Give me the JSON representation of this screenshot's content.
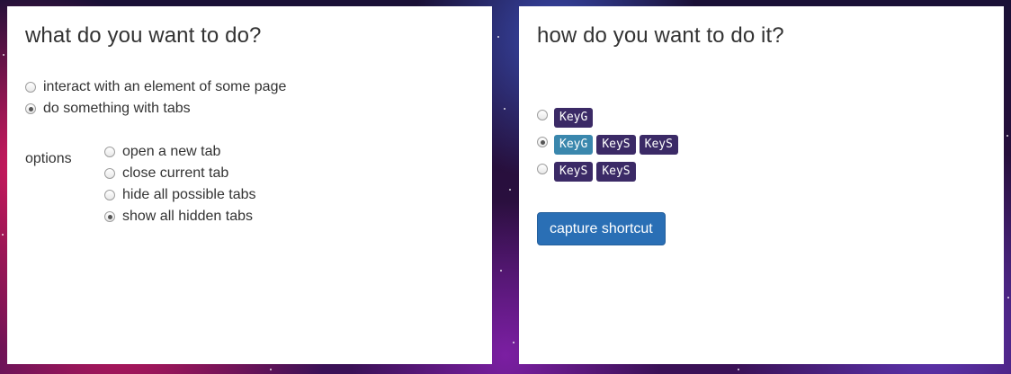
{
  "left_panel": {
    "title": "what do you want to do?",
    "actions": [
      {
        "label": "interact with an element of some page",
        "checked": false
      },
      {
        "label": "do something with tabs",
        "checked": true
      }
    ],
    "options_label": "options",
    "options": [
      {
        "label": "open a new tab",
        "checked": false
      },
      {
        "label": "close current tab",
        "checked": false
      },
      {
        "label": "hide all possible tabs",
        "checked": false
      },
      {
        "label": "show all hidden tabs",
        "checked": true
      }
    ]
  },
  "right_panel": {
    "title": "how do you want to do it?",
    "shortcuts": [
      {
        "checked": false,
        "keys": [
          "KeyG"
        ]
      },
      {
        "checked": true,
        "keys": [
          "KeyG",
          "KeyS",
          "KeyS"
        ]
      },
      {
        "checked": false,
        "keys": [
          "KeyS",
          "KeyS"
        ]
      }
    ],
    "capture_label": "capture shortcut"
  },
  "colors": {
    "key_badge": "#3b2a66",
    "key_badge_active": "#3a87ad",
    "button_primary": "#2a6fb5"
  }
}
